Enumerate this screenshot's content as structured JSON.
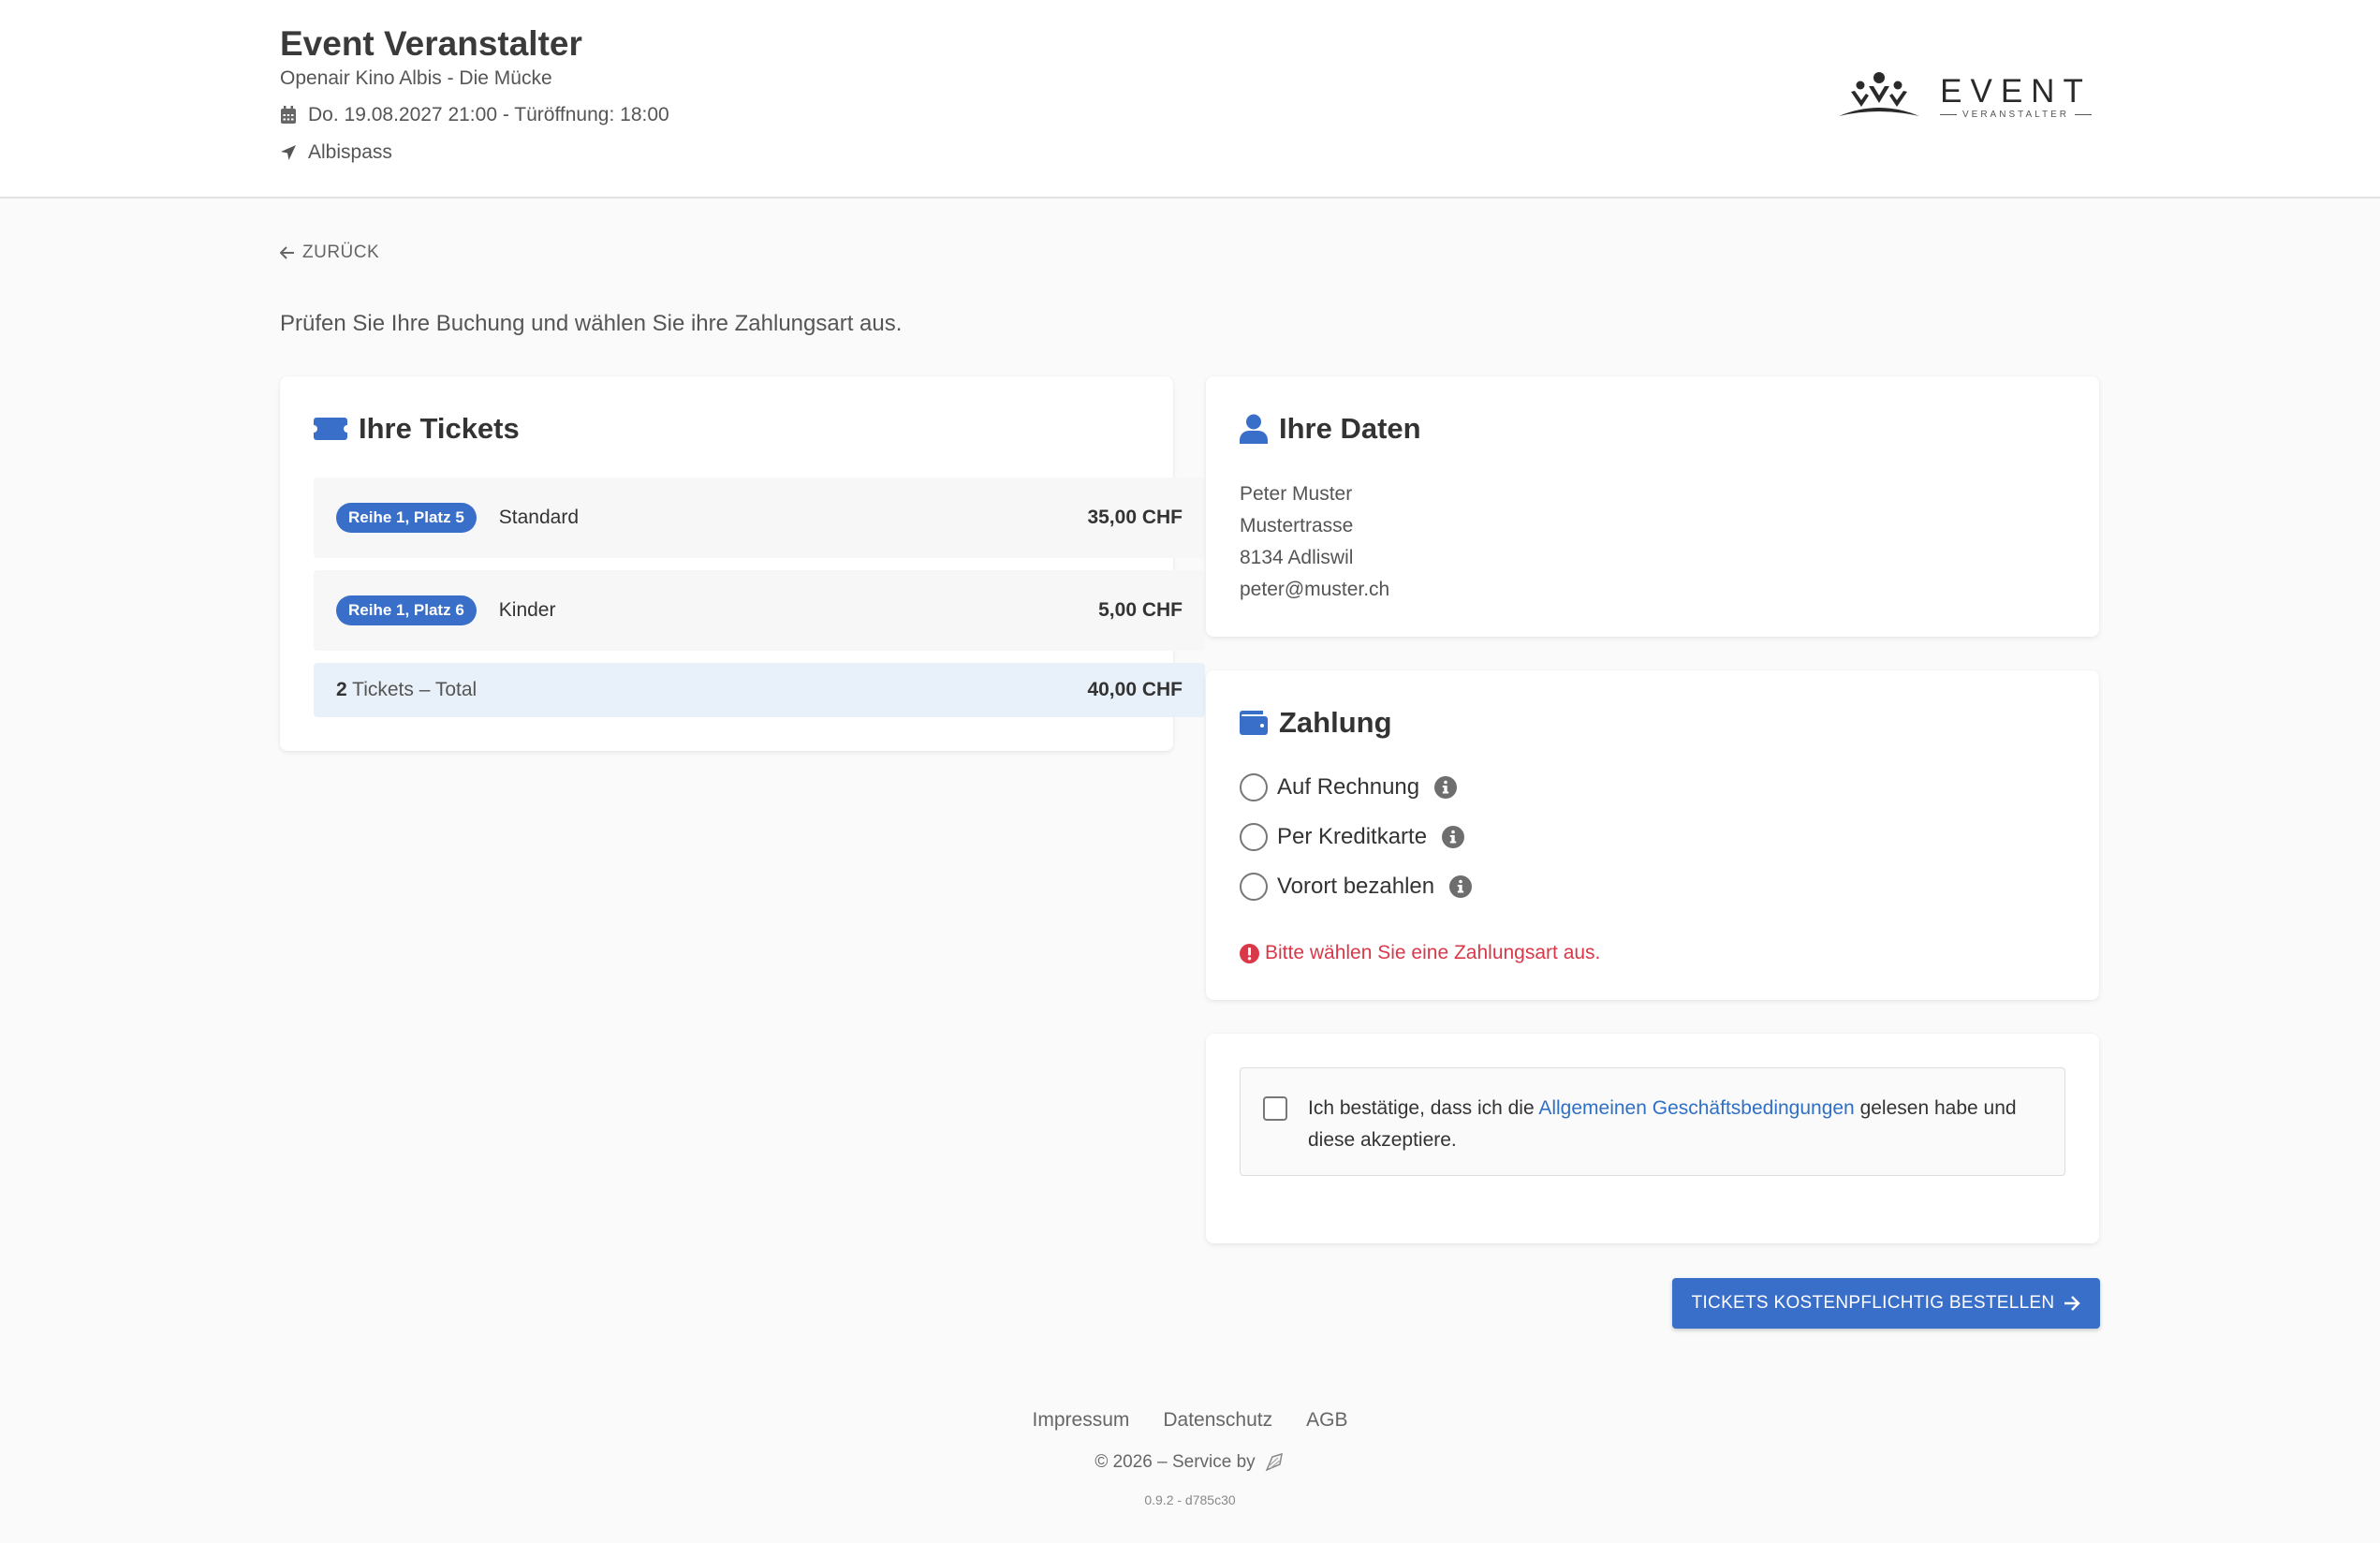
{
  "header": {
    "title": "Event Veranstalter",
    "subtitle": "Openair Kino Albis - Die Mücke",
    "date": "Do. 19.08.2027 21:00 - Türöffnung: 18:00",
    "location": "Albispass",
    "logo": {
      "main": "EVENT",
      "small": "VERANSTALTER"
    }
  },
  "nav": {
    "back_label": "ZURÜCK"
  },
  "intro": "Prüfen Sie Ihre Buchung und wählen Sie ihre Zahlungsart aus.",
  "tickets": {
    "title": "Ihre Tickets",
    "items": [
      {
        "seat": "Reihe 1, Platz 5",
        "type": "Standard",
        "price": "35,00 CHF"
      },
      {
        "seat": "Reihe 1, Platz 6",
        "type": "Kinder",
        "price": "5,00 CHF"
      }
    ],
    "total": {
      "count": "2",
      "label": "Tickets – Total",
      "price": "40,00 CHF"
    }
  },
  "customer": {
    "title": "Ihre Daten",
    "name": "Peter Muster",
    "street": "Mustertrasse",
    "city": "8134 Adliswil",
    "email": "peter@muster.ch"
  },
  "payment": {
    "title": "Zahlung",
    "options": [
      {
        "label": "Auf Rechnung"
      },
      {
        "label": "Per Kreditkarte"
      },
      {
        "label": "Vorort bezahlen"
      }
    ],
    "error": "Bitte wählen Sie eine Zahlungsart aus."
  },
  "agb": {
    "text_before": "Ich bestätige, dass ich die ",
    "link": "Allgemeinen Geschäftsbedingungen",
    "text_after": " gelesen habe und diese akzeptiere."
  },
  "order_button": "TICKETS KOSTENPFLICHTIG BESTELLEN",
  "footer": {
    "links": [
      "Impressum",
      "Datenschutz",
      "AGB"
    ],
    "copyright": "© 2026 – Service by",
    "version": "0.9.2 - d785c30"
  },
  "colors": {
    "accent": "#3a6fc9",
    "error": "#d93848",
    "link": "#2f6fc6"
  }
}
